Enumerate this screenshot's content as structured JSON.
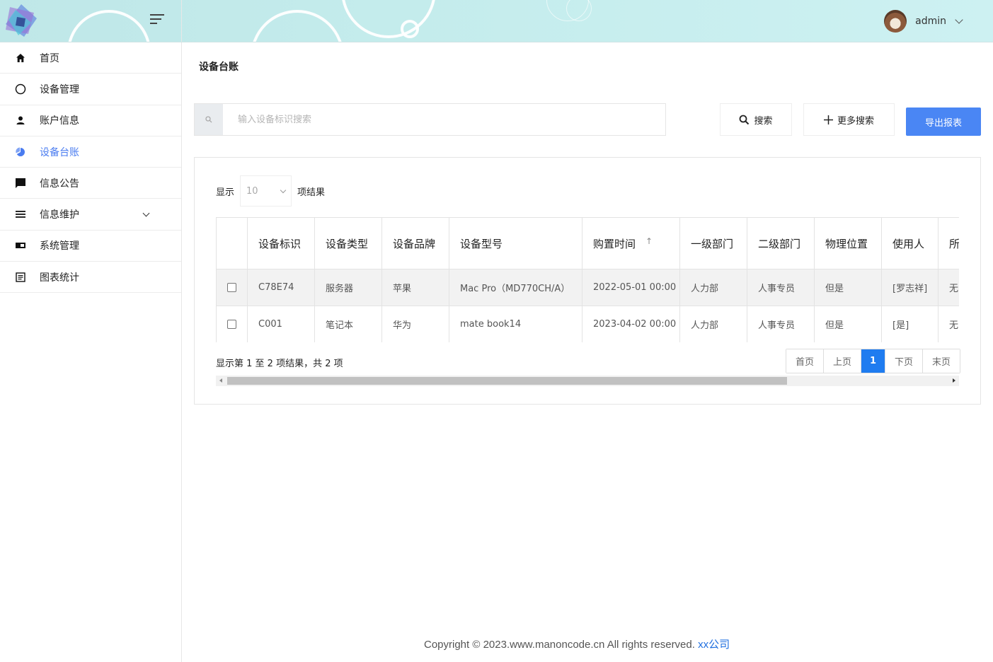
{
  "header": {
    "username": "admin",
    "logo_icon": "diamond-logo-icon",
    "menu_icon": "menu-toggle-icon"
  },
  "sidebar": {
    "items": [
      {
        "label": "首页",
        "icon": "home-icon"
      },
      {
        "label": "设备管理",
        "icon": "circle-icon"
      },
      {
        "label": "账户信息",
        "icon": "user-icon"
      },
      {
        "label": "设备台账",
        "icon": "pie-chart-icon",
        "active": true
      },
      {
        "label": "信息公告",
        "icon": "message-icon"
      },
      {
        "label": "信息维护",
        "icon": "list-icon",
        "expandable": true
      },
      {
        "label": "系统管理",
        "icon": "id-card-icon"
      },
      {
        "label": "图表统计",
        "icon": "document-icon"
      }
    ]
  },
  "main": {
    "title": "设备台账",
    "search": {
      "placeholder": "输入设备标识搜索",
      "value": ""
    },
    "buttons": {
      "search": "搜索",
      "more_search": "更多搜索",
      "export": "导出报表"
    },
    "length": {
      "prefix": "显示",
      "value": "10",
      "suffix": "项结果"
    },
    "table": {
      "columns": [
        "设备标识",
        "设备类型",
        "设备品牌",
        "设备型号",
        "购置时间",
        "一级部门",
        "二级部门",
        "物理位置",
        "使用人",
        "所"
      ],
      "rows": [
        [
          "C78E74",
          "服务器",
          "苹果",
          "Mac Pro（MD770CH/A）",
          "2022-05-01 00:00",
          "人力部",
          "人事专员",
          "但是",
          "[罗志祥]",
          "无"
        ],
        [
          "C001",
          "笔记本",
          "华为",
          "mate book14",
          "2023-04-02 00:00",
          "人力部",
          "人事专员",
          "但是",
          "[是]",
          "无"
        ]
      ]
    },
    "info": "显示第 1 至 2 项结果，共 2 项",
    "pager": {
      "first": "首页",
      "prev": "上页",
      "current": "1",
      "next": "下页",
      "last": "末页"
    }
  },
  "footer": {
    "text": "Copyright © 2023.www.manoncode.cn All rights reserved. ",
    "link": "xx公司"
  },
  "colors": {
    "accent": "#4a7cf0",
    "export_button": "#4a86f4",
    "pager_active": "#1f7cf0"
  }
}
